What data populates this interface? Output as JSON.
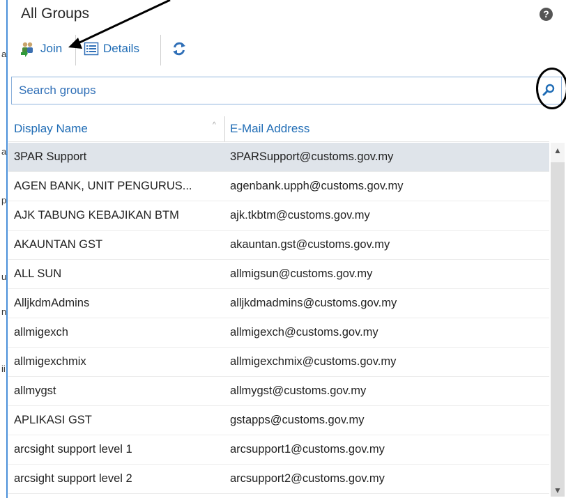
{
  "header": {
    "title": "All Groups",
    "help_symbol": "?"
  },
  "toolbar": {
    "join_label": "Join",
    "details_label": "Details"
  },
  "search": {
    "placeholder": "Search groups",
    "value": ""
  },
  "table": {
    "columns": [
      "Display Name",
      "E-Mail Address"
    ],
    "rows": [
      {
        "name": "3PAR Support",
        "email": "3PARSupport@customs.gov.my",
        "selected": true
      },
      {
        "name": "AGEN BANK, UNIT PENGURUS...",
        "email": "agenbank.upph@customs.gov.my"
      },
      {
        "name": "AJK TABUNG KEBAJIKAN BTM",
        "email": "ajk.tkbtm@customs.gov.my"
      },
      {
        "name": "AKAUNTAN GST",
        "email": "akauntan.gst@customs.gov.my"
      },
      {
        "name": "ALL SUN",
        "email": "allmigsun@customs.gov.my"
      },
      {
        "name": "AlljkdmAdmins",
        "email": "alljkdmadmins@customs.gov.my"
      },
      {
        "name": "allmigexch",
        "email": "allmigexch@customs.gov.my"
      },
      {
        "name": "allmigexchmix",
        "email": "allmigexchmix@customs.gov.my"
      },
      {
        "name": "allmygst",
        "email": "allmygst@customs.gov.my"
      },
      {
        "name": "APLIKASI GST",
        "email": "gstapps@customs.gov.my"
      },
      {
        "name": "arcsight support level 1",
        "email": "arcsupport1@customs.gov.my"
      },
      {
        "name": "arcsight support level 2",
        "email": "arcsupport2@customs.gov.my"
      }
    ]
  },
  "left_strip": {
    "fragments": [
      "a",
      "a",
      "p",
      "u",
      "n",
      "ii"
    ]
  },
  "colors": {
    "accent": "#1f6cb5",
    "selected_row": "#dfe4ea",
    "border": "#8fb3dc"
  }
}
